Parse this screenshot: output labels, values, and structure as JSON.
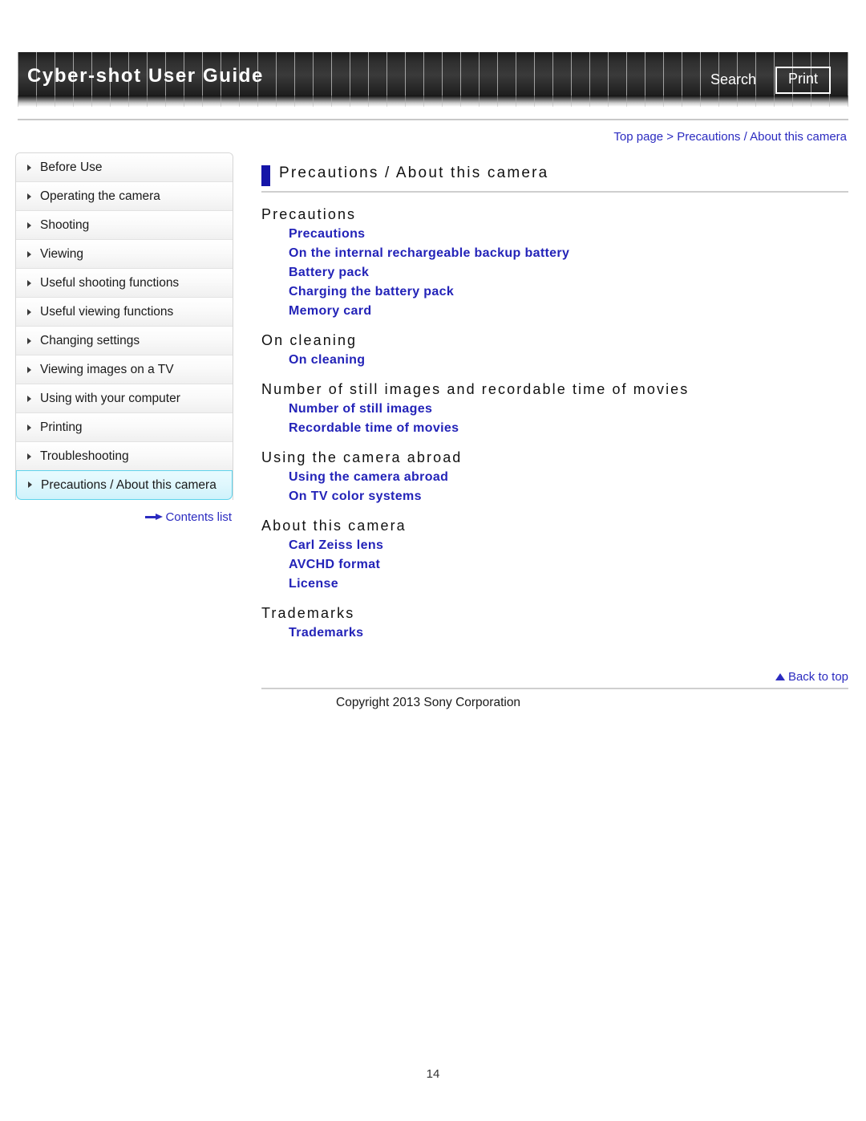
{
  "header": {
    "guide_title": "Cyber-shot User Guide",
    "search_label": "Search",
    "print_label": "Print"
  },
  "breadcrumb": {
    "top_page": "Top page",
    "separator": ">",
    "current": "Precautions / About this camera"
  },
  "sidebar": {
    "items": [
      {
        "label": "Before Use",
        "selected": false
      },
      {
        "label": "Operating the camera",
        "selected": false
      },
      {
        "label": "Shooting",
        "selected": false
      },
      {
        "label": "Viewing",
        "selected": false
      },
      {
        "label": "Useful shooting functions",
        "selected": false
      },
      {
        "label": "Useful viewing functions",
        "selected": false
      },
      {
        "label": "Changing settings",
        "selected": false
      },
      {
        "label": "Viewing images on a TV",
        "selected": false
      },
      {
        "label": "Using with your computer",
        "selected": false
      },
      {
        "label": "Printing",
        "selected": false
      },
      {
        "label": "Troubleshooting",
        "selected": false
      },
      {
        "label": "Precautions / About this camera",
        "selected": true
      }
    ],
    "contents_list_label": "Contents list"
  },
  "main": {
    "page_title": "Precautions / About this camera",
    "sections": [
      {
        "heading": "Precautions",
        "links": [
          "Precautions",
          "On the internal rechargeable backup battery",
          "Battery pack",
          "Charging the battery pack",
          "Memory card"
        ]
      },
      {
        "heading": "On cleaning",
        "links": [
          "On cleaning"
        ]
      },
      {
        "heading": "Number of still images and recordable time of movies",
        "links": [
          "Number of still images",
          "Recordable time of movies"
        ]
      },
      {
        "heading": "Using the camera abroad",
        "links": [
          "Using the camera abroad",
          "On TV color systems"
        ]
      },
      {
        "heading": "About this camera",
        "links": [
          "Carl Zeiss lens",
          "AVCHD format",
          "License"
        ]
      },
      {
        "heading": "Trademarks",
        "links": [
          "Trademarks"
        ]
      }
    ]
  },
  "footer": {
    "back_to_top_label": "Back to top",
    "copyright": "Copyright 2013 Sony Corporation"
  },
  "page_number": "14",
  "colors": {
    "link_blue": "#2323b8",
    "breadcrumb_blue": "#2b2bc0",
    "title_accent": "#1515a8",
    "selected_border": "#5fd4ec",
    "selected_bg": "#dff7fd"
  }
}
